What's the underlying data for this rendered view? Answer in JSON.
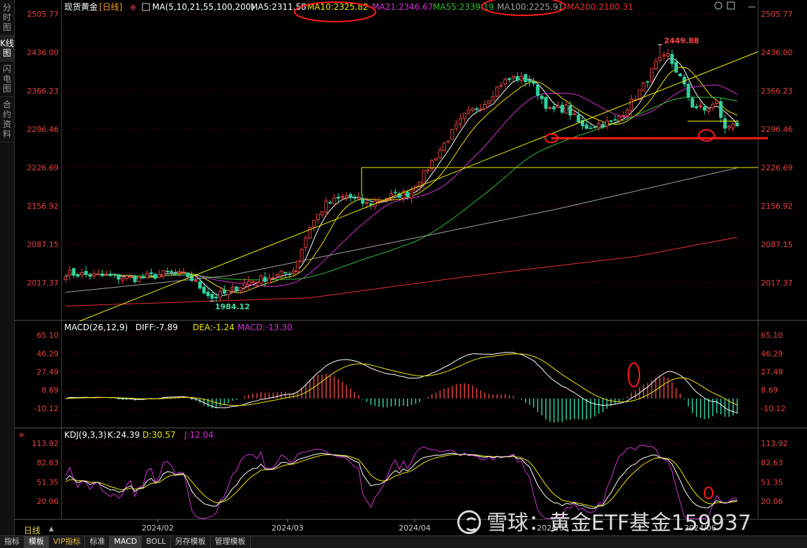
{
  "sidebar": {
    "tabs": [
      {
        "label": "分时图",
        "active": false
      },
      {
        "label": "K线图",
        "active": true
      },
      {
        "label": "闪电图",
        "active": false
      },
      {
        "label": "合约资料",
        "active": false
      }
    ]
  },
  "header": {
    "title": "现货黄金",
    "period": "[日线]",
    "ma_header": "MA(5,10,21,55,100,200)",
    "ma_values": [
      {
        "text": "MA5:2311.58",
        "color": "#ffffff"
      },
      {
        "text": "MA10:2325.82",
        "color": "#f2e600"
      },
      {
        "text": "MA21:2346.67",
        "color": "#d830d8"
      },
      {
        "text": "MA55:2339.19",
        "color": "#30c030"
      },
      {
        "text": "MA100:2225.91",
        "color": "#a0a0a0"
      },
      {
        "text": "MA200:2100.31",
        "color": "#e83030"
      }
    ]
  },
  "toolbar_icons": [
    "settings-icon",
    "window-icon",
    "minimize-icon"
  ],
  "bottom_tabs": [
    {
      "label": "指标",
      "active": false,
      "vip": false
    },
    {
      "label": "模板",
      "active": true,
      "vip": false
    },
    {
      "label": "VIP指标",
      "active": false,
      "vip": true
    },
    {
      "label": "标准",
      "active": false,
      "vip": false
    },
    {
      "label": "MACD",
      "active": true,
      "vip": false
    },
    {
      "label": "BOLL",
      "active": false,
      "vip": false
    },
    {
      "label": "另存模板",
      "active": false,
      "vip": false
    },
    {
      "label": "管理模板",
      "active": false,
      "vip": false
    }
  ],
  "period_selector": "日线",
  "watermark": "雪球：黄金ETF基金159937",
  "colors": {
    "up": "#e84040",
    "down": "#30d0a0",
    "axis_text": "#e84040",
    "grid": "#3a0000",
    "trendline": "#f2f200",
    "support": "#ff1a1a"
  },
  "chart_data": [
    {
      "type": "candlestick",
      "title": "现货黄金 [日线]",
      "x_labels": [
        "2024/02",
        "2024/03",
        "2024/04",
        "2024/05",
        "2024/06"
      ],
      "y_ticks": [
        2505.77,
        2436.0,
        2366.23,
        2296.46,
        2226.69,
        2156.92,
        2087.15,
        2017.37
      ],
      "ylim": [
        1960,
        2520
      ],
      "annotations": [
        {
          "text": "2449.88",
          "type": "high",
          "value": 2449.88
        },
        {
          "text": "1984.12",
          "type": "low",
          "value": 1984.12
        }
      ],
      "key_points": {
        "start_close": 2035,
        "feb_low": 1984.12,
        "mar_breakout": 2150,
        "apr_high": 2431,
        "may_high": 2449.88,
        "june_low": 2287,
        "last_close": 2305
      },
      "horizontal_lines": [
        2226.69,
        2311,
        2280
      ],
      "moving_averages": [
        "MA5",
        "MA10",
        "MA21",
        "MA55",
        "MA100",
        "MA200"
      ]
    },
    {
      "type": "bar",
      "title": "MACD(26,12,9)",
      "legend": [
        {
          "text": "MACD(26,12,9)",
          "color": "#ffffff"
        },
        {
          "text": "DIFF:-7.89",
          "color": "#ffffff"
        },
        {
          "text": "DEA:-1.24",
          "color": "#f2e600"
        },
        {
          "text": "MACD:-13.30",
          "color": "#d830d8"
        }
      ],
      "y_ticks": [
        65.1,
        46.29,
        27.49,
        8.69,
        -10.12
      ],
      "ylim": [
        -30,
        70
      ]
    },
    {
      "type": "line",
      "title": "KDJ(9,3,3)",
      "legend": [
        {
          "text": "KDJ(9,3,3)",
          "color": "#ffffff"
        },
        {
          "text": "K:24.39",
          "color": "#ffffff"
        },
        {
          "text": "D:30.57",
          "color": "#f2e600"
        },
        {
          "text": "J:12.04",
          "color": "#d830d8"
        }
      ],
      "y_ticks": [
        113.92,
        82.63,
        51.35,
        20.06
      ],
      "ylim": [
        -10,
        125
      ]
    }
  ]
}
